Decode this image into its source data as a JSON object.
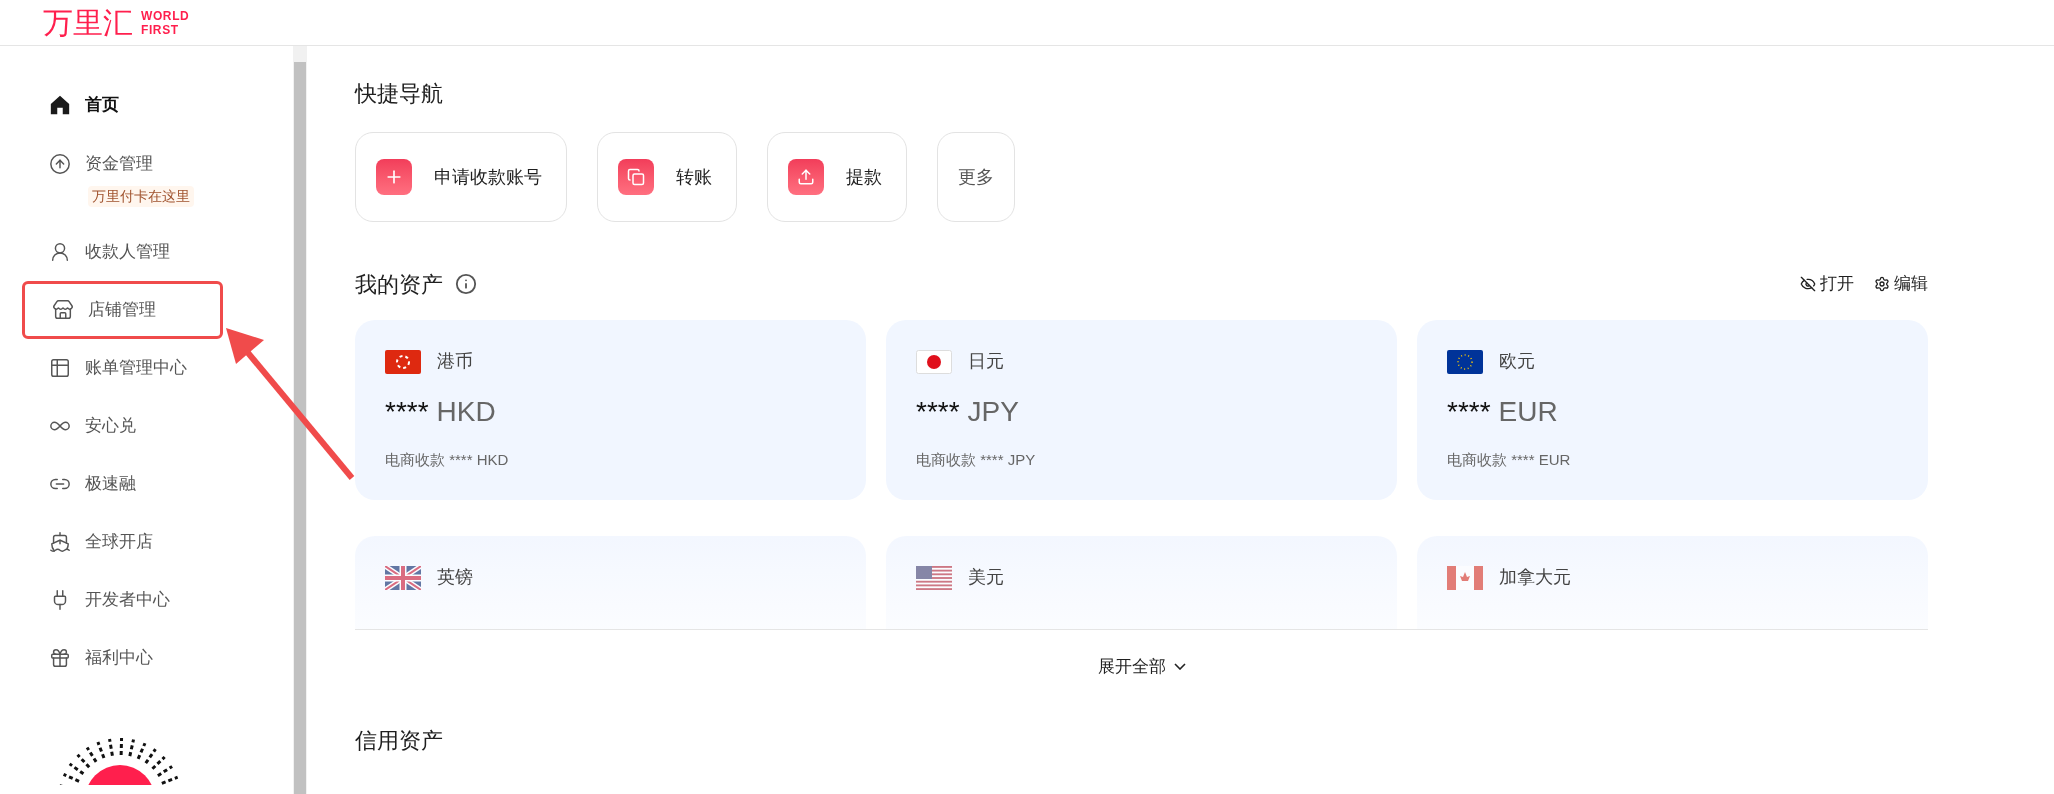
{
  "logo": {
    "name": "万里汇",
    "tagline_1": "WORLD",
    "tagline_2": "FIRST"
  },
  "sidebar": {
    "items": [
      {
        "label": "首页",
        "selected": true,
        "highlighted": false
      },
      {
        "label": "资金管理",
        "selected": false,
        "highlighted": false,
        "badge": "万里付卡在这里"
      },
      {
        "label": "收款人管理",
        "selected": false,
        "highlighted": false
      },
      {
        "label": "店铺管理",
        "selected": false,
        "highlighted": true
      },
      {
        "label": "账单管理中心",
        "selected": false,
        "highlighted": false
      },
      {
        "label": "安心兑",
        "selected": false,
        "highlighted": false
      },
      {
        "label": "极速融",
        "selected": false,
        "highlighted": false
      },
      {
        "label": "全球开店",
        "selected": false,
        "highlighted": false
      },
      {
        "label": "开发者中心",
        "selected": false,
        "highlighted": false
      },
      {
        "label": "福利中心",
        "selected": false,
        "highlighted": false
      }
    ]
  },
  "quick_nav": {
    "title": "快捷导航",
    "items": [
      {
        "label": "申请收款账号",
        "kind": "plus"
      },
      {
        "label": "转账",
        "kind": "transfer"
      },
      {
        "label": "提款",
        "kind": "withdraw"
      },
      {
        "label": "更多",
        "kind": "text"
      }
    ]
  },
  "assets": {
    "title": "我的资产",
    "actions": [
      "打开",
      "编辑"
    ],
    "cards": [
      {
        "currency": "港币",
        "mask": "****",
        "code": "HKD",
        "subtitle": "电商收款 **** HKD",
        "faded": false
      },
      {
        "currency": "日元",
        "mask": "****",
        "code": "JPY",
        "subtitle": "电商收款 **** JPY",
        "faded": false
      },
      {
        "currency": "欧元",
        "mask": "****",
        "code": "EUR",
        "subtitle": "电商收款 **** EUR",
        "faded": false
      },
      {
        "currency": "英镑",
        "faded": true
      },
      {
        "currency": "美元",
        "faded": true
      },
      {
        "currency": "加拿大元",
        "faded": true
      }
    ],
    "expand": "展开全部"
  },
  "credit_assets": {
    "title": "信用资产"
  }
}
